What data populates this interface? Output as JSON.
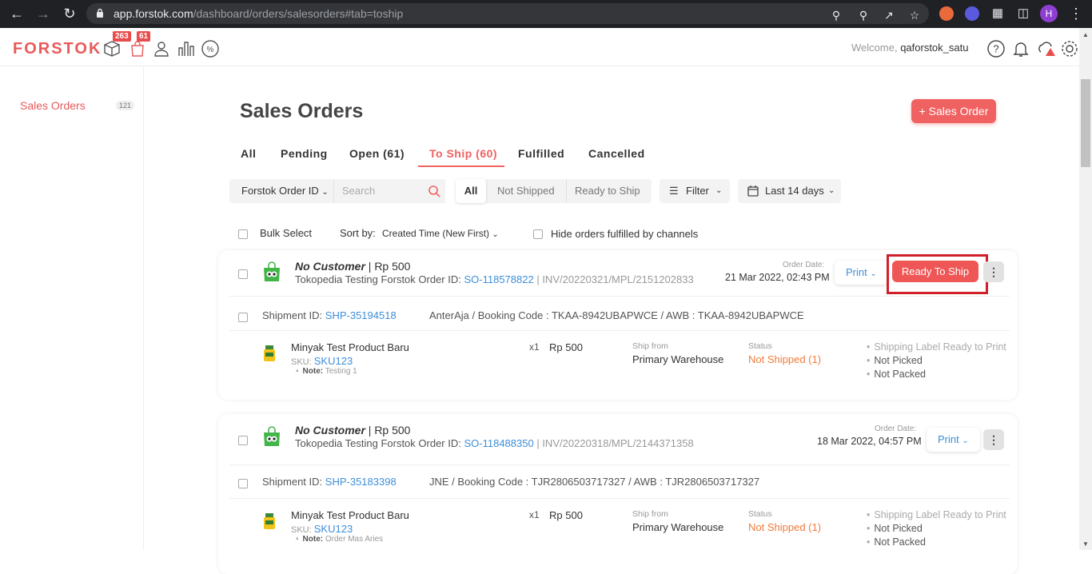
{
  "browser": {
    "url_host": "app.forstok.com",
    "url_path": "/dashboard/orders/salesorders#tab=toship",
    "profile_initial": "H"
  },
  "topbar": {
    "logo": "FORSTOK",
    "badge_inventory": "263",
    "badge_orders": "61",
    "welcome": "Welcome,",
    "username": "qaforstok_satu"
  },
  "sidebar": {
    "item": "Sales Orders",
    "count": "121"
  },
  "main": {
    "title": "Sales Orders",
    "add_button": "+ Sales Order",
    "tabs": [
      "All",
      "Pending",
      "Open (61)",
      "To Ship (60)",
      "Fulfilled",
      "Cancelled"
    ],
    "search_field": "Forstok Order ID",
    "search_placeholder": "Search",
    "ship_filters": [
      "All",
      "Not Shipped",
      "Ready to Ship"
    ],
    "filter_label": "Filter",
    "date_label": "Last 14 days",
    "bulk_select": "Bulk Select",
    "sort_label": "Sort by:",
    "sort_value": "Created Time (New First)",
    "hide_label": "Hide orders fulfilled by channels"
  },
  "orders": [
    {
      "customer": "No Customer",
      "amount": "| Rp 500",
      "channel": "Tokopedia Testing Forstok Order ID:",
      "so": "SO-118578822",
      "inv": "| INV/20220321/MPL/2151202833",
      "date_label": "Order Date:",
      "date": "21 Mar 2022, 02:43 PM",
      "print": "Print",
      "action": "Ready To Ship",
      "shipment_label": "Shipment ID:",
      "shipment": "SHP-35194518",
      "courier": "AnterAja / Booking Code : TKAA-8942UBAPWCE / AWB : TKAA-8942UBAPWCE",
      "product": "Minyak Test Product Baru",
      "sku_label": "SKU:",
      "sku": "SKU123",
      "note_label": "Note:",
      "note": "Testing 1",
      "qty": "x1",
      "price": "Rp 500",
      "ship_from_label": "Ship from",
      "ship_from": "Primary Warehouse",
      "status_label": "Status",
      "status": "Not Shipped (1)",
      "checks": [
        "Shipping Label Ready to Print",
        "Not Picked",
        "Not Packed"
      ]
    },
    {
      "customer": "No Customer",
      "amount": "| Rp 500",
      "channel": "Tokopedia Testing Forstok Order ID:",
      "so": "SO-118488350",
      "inv": "| INV/20220318/MPL/2144371358",
      "date_label": "Order Date:",
      "date": "18 Mar 2022, 04:57 PM",
      "print": "Print",
      "shipment_label": "Shipment ID:",
      "shipment": "SHP-35183398",
      "courier": "JNE / Booking Code : TJR2806503717327 / AWB : TJR2806503717327",
      "product": "Minyak Test Product Baru",
      "sku_label": "SKU:",
      "sku": "SKU123",
      "note_label": "Note:",
      "note": "Order Mas Aries",
      "qty": "x1",
      "price": "Rp 500",
      "ship_from_label": "Ship from",
      "ship_from": "Primary Warehouse",
      "status_label": "Status",
      "status": "Not Shipped (1)",
      "checks": [
        "Shipping Label Ready to Print",
        "Not Picked",
        "Not Packed"
      ]
    }
  ],
  "colors": {
    "brand": "#e85a5a",
    "accent": "#f06262",
    "link": "#3d8ed8",
    "highlight": "#d0202a"
  }
}
